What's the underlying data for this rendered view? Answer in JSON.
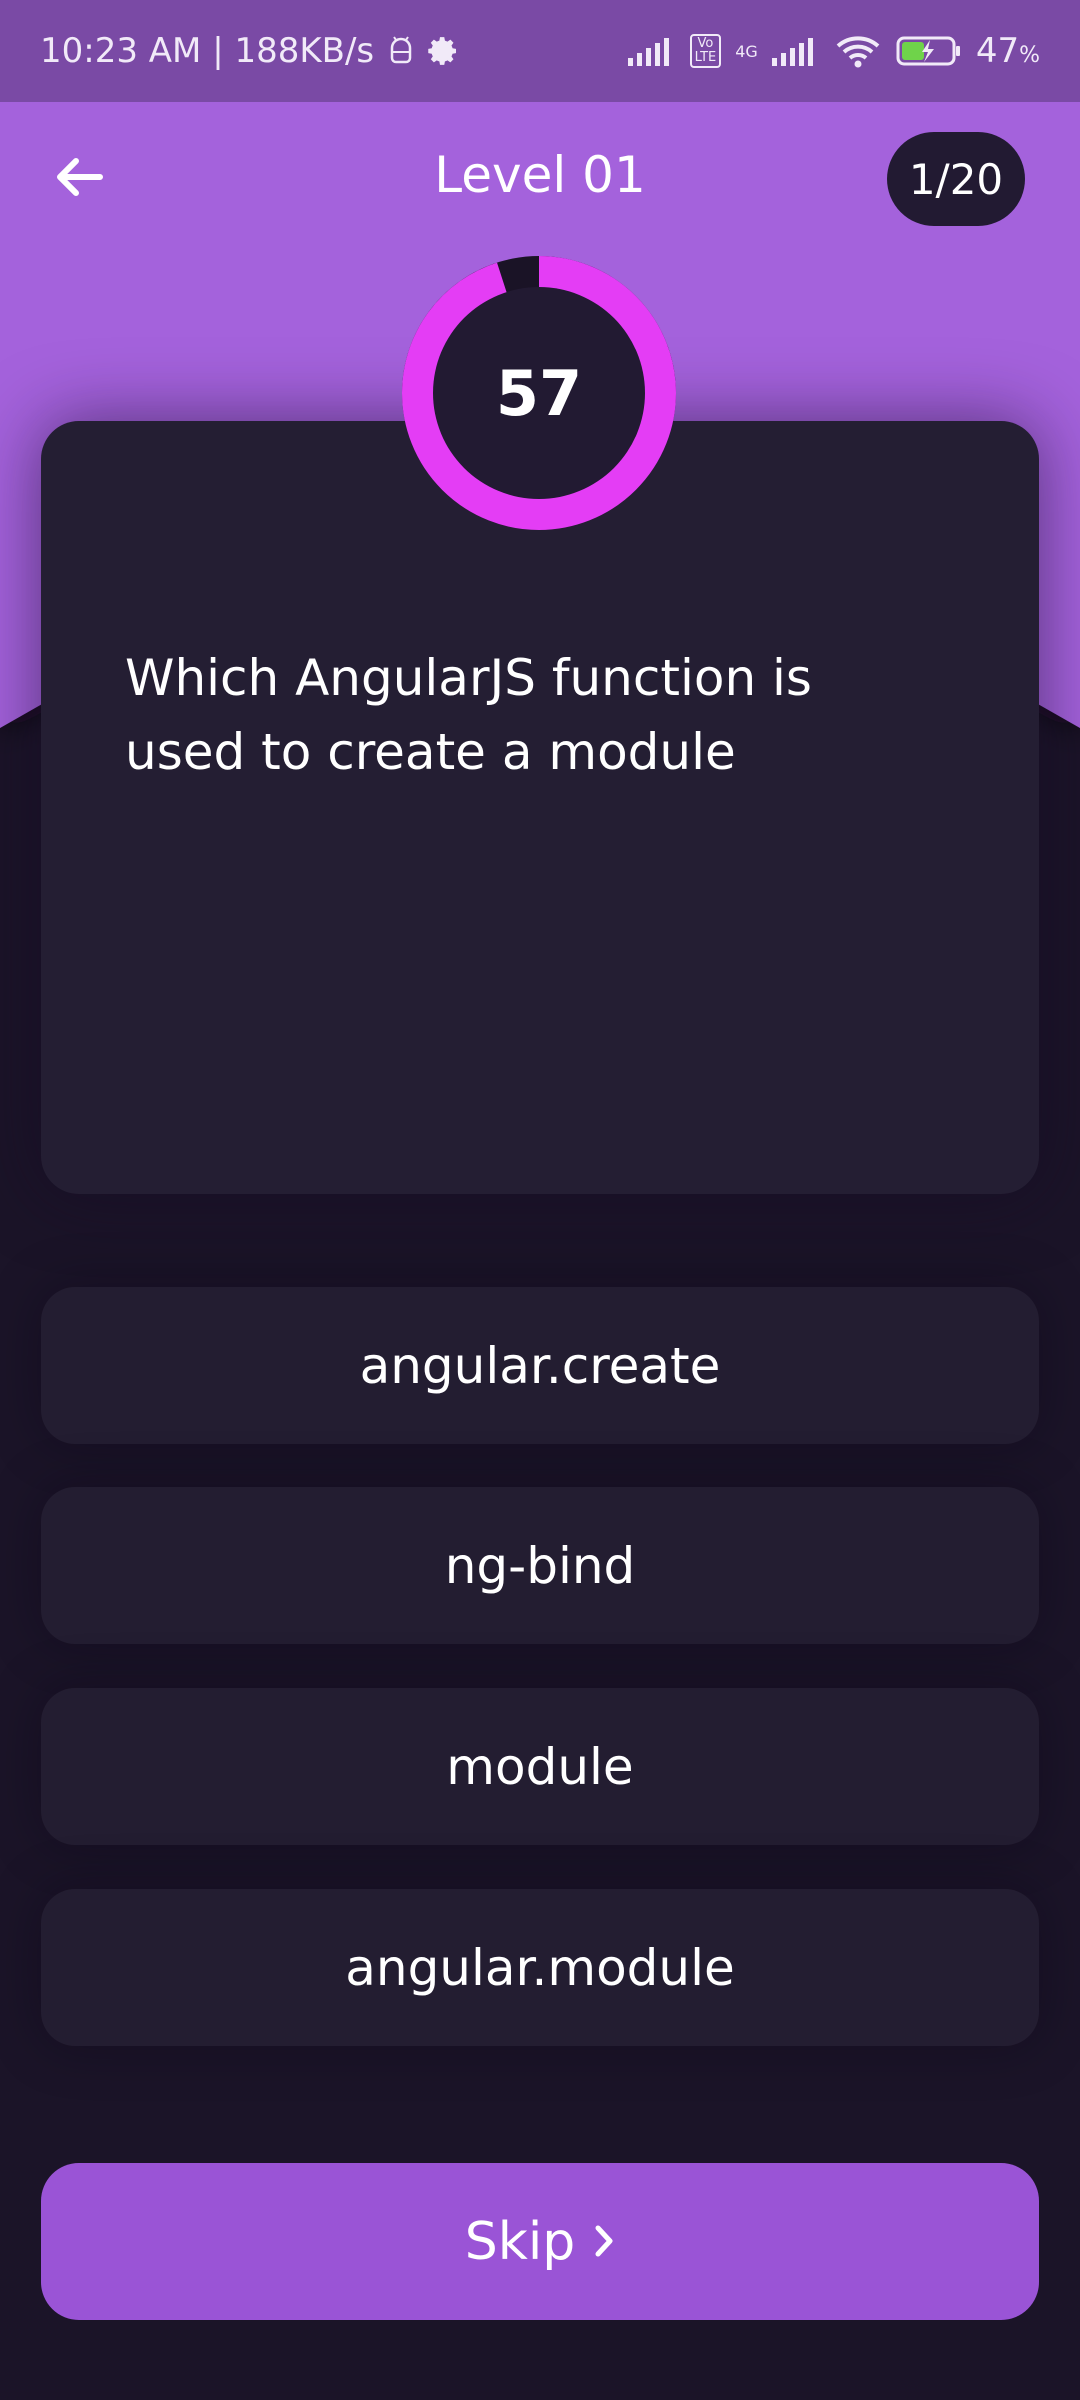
{
  "status_bar": {
    "time_speed": "10:23 AM | 188KB/s",
    "volte": "Vo\nLTE",
    "network": "4G",
    "battery_percent": "47",
    "percent_symbol": "%"
  },
  "header": {
    "title": "Level 01",
    "counter": "1/20"
  },
  "timer": {
    "value": "57",
    "progress": 0.95,
    "colors": {
      "ring": "#e43df5",
      "track": "#1a1326",
      "center": "#221a32"
    }
  },
  "question": {
    "text": "Which AngularJS function is used to create a module"
  },
  "options": [
    {
      "label": "angular.create"
    },
    {
      "label": "ng-bind"
    },
    {
      "label": "module"
    },
    {
      "label": "angular.module"
    }
  ],
  "skip": {
    "label": "Skip"
  },
  "colors": {
    "background": "#1b1428",
    "hero": "#a462dc",
    "status_bar": "#7a4aa5",
    "card": "#241e33",
    "accent": "#9a54d6"
  },
  "icons": {
    "back": "arrow-left-icon",
    "skip": "chevron-right-icon",
    "settings": "gear-icon",
    "android": "android-icon",
    "signal": "signal-bars-icon",
    "wifi": "wifi-icon",
    "battery": "battery-charging-icon"
  }
}
